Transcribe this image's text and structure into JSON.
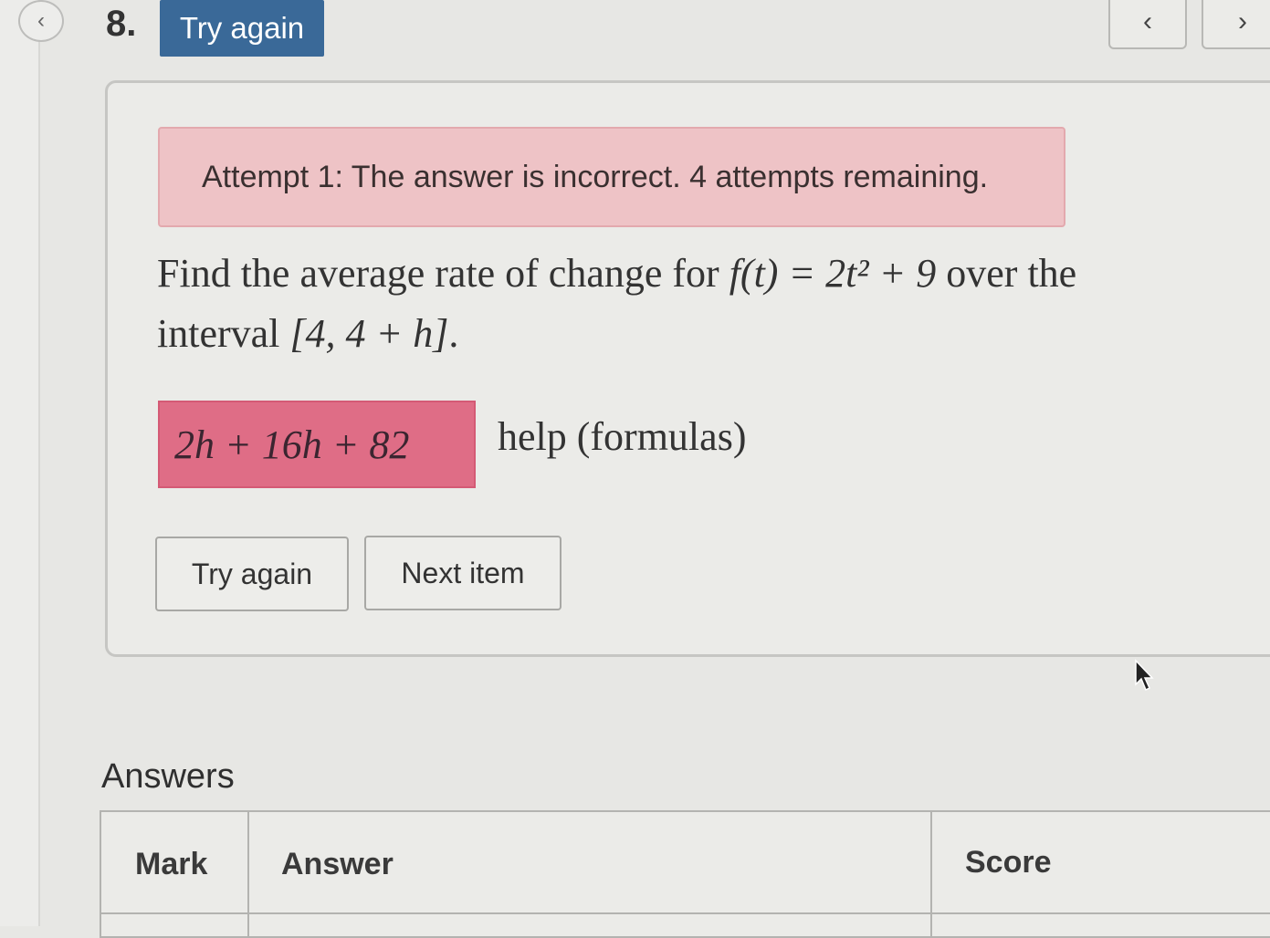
{
  "header": {
    "back_icon": "chevron-left-icon",
    "item_number": "8.",
    "status_badge": "Try again",
    "prev_icon": "chevron-left-icon",
    "next_icon": "chevron-right-icon"
  },
  "question": {
    "alert": "Attempt 1: The answer is incorrect. 4 attempts remaining.",
    "prompt_lead": "Find the average rate of change for ",
    "function_expr": "f(t) = 2t² + 9",
    "prompt_mid": " over the interval ",
    "interval_expr": "[4, 4 + h]",
    "prompt_end": ".",
    "answer_value": "2h + 16h + 82",
    "help_link": "help (formulas)",
    "try_again_label": "Try again",
    "next_item_label": "Next item"
  },
  "answers": {
    "heading": "Answers",
    "columns": [
      "Mark",
      "Answer",
      "Score"
    ]
  },
  "colors": {
    "status_badge": "#3a6998",
    "alert_bg": "#eec3c6",
    "answer_incorrect_bg": "#df6d86"
  }
}
